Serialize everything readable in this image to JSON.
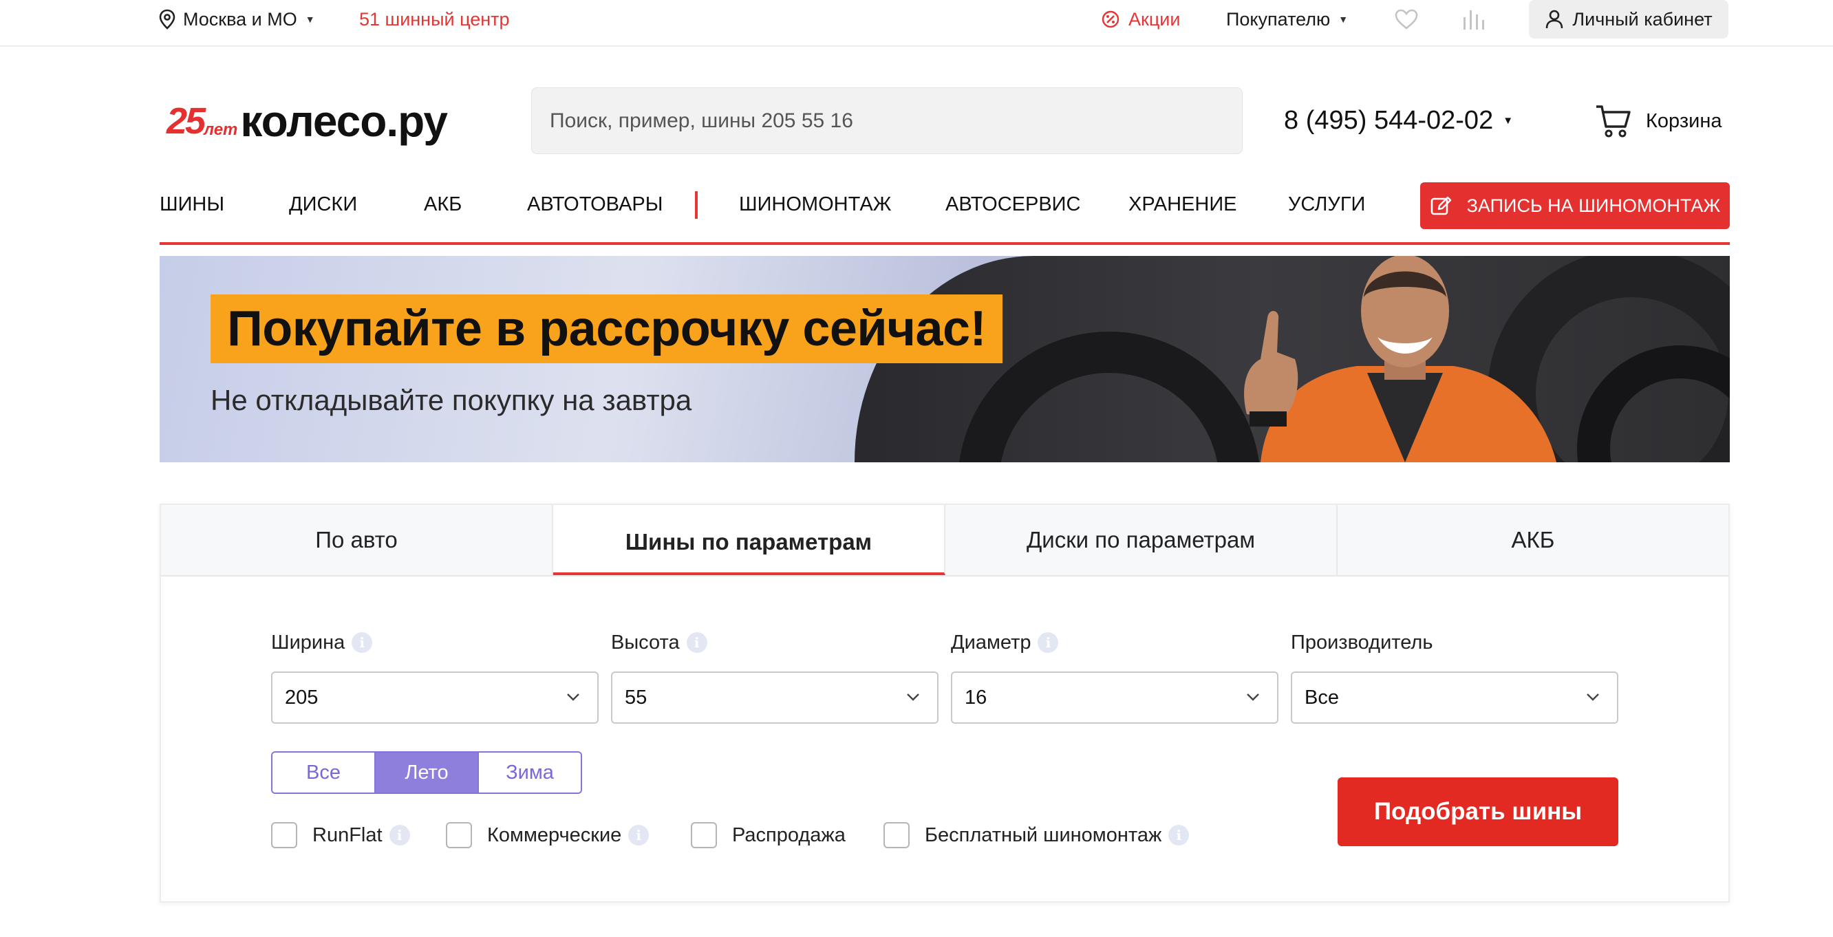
{
  "topbar": {
    "city": "Москва и МО",
    "center_link": "51 шинный центр",
    "promo": "Акции",
    "buyer": "Покупателю",
    "cabinet": "Личный кабинет"
  },
  "header": {
    "logo_years": "25",
    "logo_years_suffix": "лет",
    "logo_name": "колесо.ру",
    "search_placeholder": "Поиск, пример, шины 205 55 16",
    "phone": "8 (495) 544-02-02",
    "cart": "Корзина"
  },
  "nav": {
    "items": [
      "ШИНЫ",
      "ДИСКИ",
      "АКБ",
      "АВТОТОВАРЫ",
      "ШИНОМОНТАЖ",
      "АВТОСЕРВИС",
      "ХРАНЕНИЕ",
      "УСЛУГИ"
    ],
    "cta": "ЗАПИСЬ НА ШИНОМОНТАЖ"
  },
  "banner": {
    "headline": "Покупайте в рассрочку сейчас!",
    "subtitle": "Не откладывайте покупку на завтра"
  },
  "picker": {
    "tabs": [
      "По авто",
      "Шины по параметрам",
      "Диски по параметрам",
      "АКБ"
    ],
    "active_tab": "Шины по параметрам",
    "fields": [
      {
        "label": "Ширина",
        "value": "205",
        "has_info": true
      },
      {
        "label": "Высота",
        "value": "55",
        "has_info": true
      },
      {
        "label": "Диаметр",
        "value": "16",
        "has_info": true
      },
      {
        "label": "Производитель",
        "value": "Все",
        "has_info": false
      }
    ],
    "seasons": [
      "Все",
      "Лето",
      "Зима"
    ],
    "selected_season": "Лето",
    "checkboxes": [
      {
        "label": "RunFlat",
        "has_info": true,
        "checked": false
      },
      {
        "label": "Коммерческие",
        "has_info": true,
        "checked": false
      },
      {
        "label": "Распродажа",
        "has_info": false,
        "checked": false
      },
      {
        "label": "Бесплатный шиномонтаж",
        "has_info": true,
        "checked": false
      }
    ],
    "submit": "Подобрать шины",
    "info_glyph": "i"
  },
  "colors": {
    "brand_red": "#e53535",
    "season_accent": "#8e7fdc",
    "banner_orange": "#f9a21b"
  }
}
